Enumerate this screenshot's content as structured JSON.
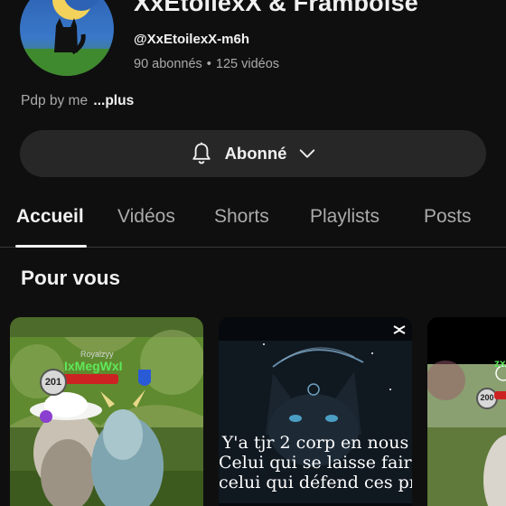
{
  "channel": {
    "name": "XxEtoilexX & Framboise",
    "handle": "@XxEtoilexX-m6h",
    "subscribers": "90 abonnés",
    "separator": "•",
    "videos": "125 vidéos",
    "description": "Pdp by me",
    "more_label": "...plus"
  },
  "subscribe_button": {
    "label": "Abonné",
    "bell_icon": "bell-icon",
    "chevron_icon": "chevron-down-icon"
  },
  "tabs": [
    {
      "label": "Accueil",
      "active": true
    },
    {
      "label": "Vidéos"
    },
    {
      "label": "Shorts"
    },
    {
      "label": "Playlists"
    },
    {
      "label": "Posts"
    }
  ],
  "section": {
    "title": "Pour vous"
  },
  "shorts": [
    {
      "game_name": "Royalzyy",
      "player_name": "IxMegWxI",
      "level": "201"
    },
    {
      "overlay_lines": [
        "Y'a tjr 2 corp en nous",
        "Celui qui se laisse faire",
        "celui qui défend ces proc"
      ],
      "badge_icon": "capcut-icon"
    },
    {
      "player_name": "zxMa",
      "level": "200"
    }
  ],
  "colors": {
    "background": "#0f0f0f",
    "button_bg": "#272727",
    "text_primary": "#f1f1f1",
    "text_secondary": "#aaaaaa",
    "player_name_green": "#5fe85a"
  }
}
